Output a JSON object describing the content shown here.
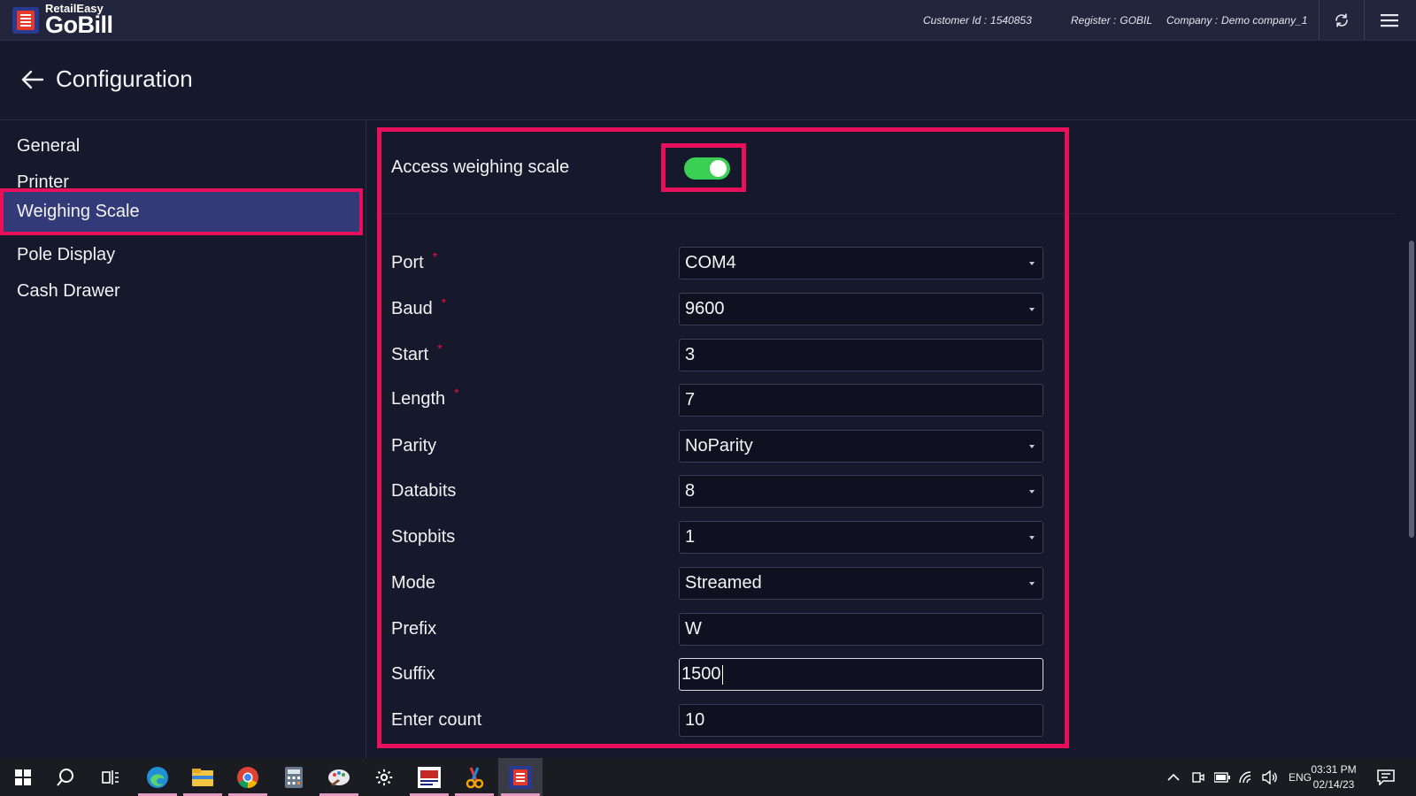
{
  "app": {
    "brand_top": "RetailEasy",
    "brand_main": "GoBill",
    "customer_label": "Customer Id :",
    "customer_value": "1540853",
    "register_label": "Register :",
    "register_value": "GOBIL",
    "company_label": "Company :",
    "company_value": "Demo company_1",
    "refresh_icon": "refresh-icon",
    "menu_icon": "hamburger-menu-icon"
  },
  "header": {
    "title": "Configuration",
    "back_icon": "arrow-left-icon"
  },
  "sidebar": {
    "items": [
      {
        "label": "General",
        "active": false
      },
      {
        "label": "Printer",
        "active": false
      },
      {
        "label": "Weighing Scale",
        "active": true
      },
      {
        "label": "Pole Display",
        "active": false
      },
      {
        "label": "Cash Drawer",
        "active": false
      }
    ]
  },
  "weighing_scale": {
    "access_label": "Access weighing scale",
    "access_enabled": true,
    "toggle_color": "#3ccf56",
    "fields": [
      {
        "label": "Port",
        "required": true,
        "type": "dropdown",
        "value": "COM4"
      },
      {
        "label": "Baud",
        "required": true,
        "type": "dropdown",
        "value": "9600"
      },
      {
        "label": "Start",
        "required": true,
        "type": "text",
        "value": "3"
      },
      {
        "label": "Length",
        "required": true,
        "type": "text",
        "value": "7"
      },
      {
        "label": "Parity",
        "required": false,
        "type": "dropdown",
        "value": "NoParity"
      },
      {
        "label": "Databits",
        "required": false,
        "type": "dropdown",
        "value": "8"
      },
      {
        "label": "Stopbits",
        "required": false,
        "type": "dropdown",
        "value": "1"
      },
      {
        "label": "Mode",
        "required": false,
        "type": "dropdown",
        "value": "Streamed"
      },
      {
        "label": "Prefix",
        "required": false,
        "type": "text",
        "value": "W"
      },
      {
        "label": "Suffix",
        "required": false,
        "type": "text",
        "value": "1500",
        "focused": true
      },
      {
        "label": "Enter count",
        "required": false,
        "type": "text",
        "value": "10"
      }
    ],
    "required_mark": "*"
  },
  "highlight_color": "#e8105a",
  "taskbar": {
    "apps": [
      "windows-start-icon",
      "search-icon",
      "task-view-icon",
      "edge-icon",
      "file-explorer-icon",
      "chrome-icon",
      "calculator-icon",
      "paint-icon",
      "settings-gear-icon",
      "retaileasy-app-icon",
      "snipping-tool-icon",
      "gobill-app-icon"
    ],
    "language": "ENG",
    "time": "03:31 PM",
    "date": "02/14/23"
  }
}
